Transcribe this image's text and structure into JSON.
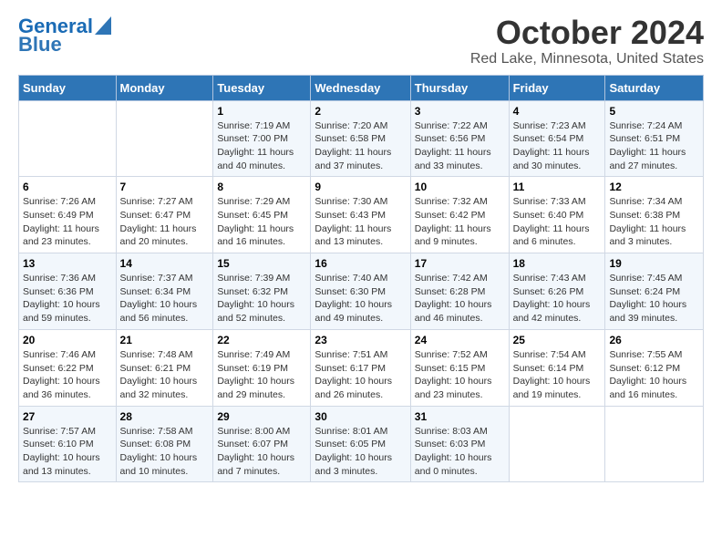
{
  "header": {
    "logo_line1": "General",
    "logo_line2": "Blue",
    "title": "October 2024",
    "subtitle": "Red Lake, Minnesota, United States"
  },
  "days_of_week": [
    "Sunday",
    "Monday",
    "Tuesday",
    "Wednesday",
    "Thursday",
    "Friday",
    "Saturday"
  ],
  "weeks": [
    [
      {
        "day": "",
        "info": ""
      },
      {
        "day": "",
        "info": ""
      },
      {
        "day": "1",
        "info": "Sunrise: 7:19 AM\nSunset: 7:00 PM\nDaylight: 11 hours and 40 minutes."
      },
      {
        "day": "2",
        "info": "Sunrise: 7:20 AM\nSunset: 6:58 PM\nDaylight: 11 hours and 37 minutes."
      },
      {
        "day": "3",
        "info": "Sunrise: 7:22 AM\nSunset: 6:56 PM\nDaylight: 11 hours and 33 minutes."
      },
      {
        "day": "4",
        "info": "Sunrise: 7:23 AM\nSunset: 6:54 PM\nDaylight: 11 hours and 30 minutes."
      },
      {
        "day": "5",
        "info": "Sunrise: 7:24 AM\nSunset: 6:51 PM\nDaylight: 11 hours and 27 minutes."
      }
    ],
    [
      {
        "day": "6",
        "info": "Sunrise: 7:26 AM\nSunset: 6:49 PM\nDaylight: 11 hours and 23 minutes."
      },
      {
        "day": "7",
        "info": "Sunrise: 7:27 AM\nSunset: 6:47 PM\nDaylight: 11 hours and 20 minutes."
      },
      {
        "day": "8",
        "info": "Sunrise: 7:29 AM\nSunset: 6:45 PM\nDaylight: 11 hours and 16 minutes."
      },
      {
        "day": "9",
        "info": "Sunrise: 7:30 AM\nSunset: 6:43 PM\nDaylight: 11 hours and 13 minutes."
      },
      {
        "day": "10",
        "info": "Sunrise: 7:32 AM\nSunset: 6:42 PM\nDaylight: 11 hours and 9 minutes."
      },
      {
        "day": "11",
        "info": "Sunrise: 7:33 AM\nSunset: 6:40 PM\nDaylight: 11 hours and 6 minutes."
      },
      {
        "day": "12",
        "info": "Sunrise: 7:34 AM\nSunset: 6:38 PM\nDaylight: 11 hours and 3 minutes."
      }
    ],
    [
      {
        "day": "13",
        "info": "Sunrise: 7:36 AM\nSunset: 6:36 PM\nDaylight: 10 hours and 59 minutes."
      },
      {
        "day": "14",
        "info": "Sunrise: 7:37 AM\nSunset: 6:34 PM\nDaylight: 10 hours and 56 minutes."
      },
      {
        "day": "15",
        "info": "Sunrise: 7:39 AM\nSunset: 6:32 PM\nDaylight: 10 hours and 52 minutes."
      },
      {
        "day": "16",
        "info": "Sunrise: 7:40 AM\nSunset: 6:30 PM\nDaylight: 10 hours and 49 minutes."
      },
      {
        "day": "17",
        "info": "Sunrise: 7:42 AM\nSunset: 6:28 PM\nDaylight: 10 hours and 46 minutes."
      },
      {
        "day": "18",
        "info": "Sunrise: 7:43 AM\nSunset: 6:26 PM\nDaylight: 10 hours and 42 minutes."
      },
      {
        "day": "19",
        "info": "Sunrise: 7:45 AM\nSunset: 6:24 PM\nDaylight: 10 hours and 39 minutes."
      }
    ],
    [
      {
        "day": "20",
        "info": "Sunrise: 7:46 AM\nSunset: 6:22 PM\nDaylight: 10 hours and 36 minutes."
      },
      {
        "day": "21",
        "info": "Sunrise: 7:48 AM\nSunset: 6:21 PM\nDaylight: 10 hours and 32 minutes."
      },
      {
        "day": "22",
        "info": "Sunrise: 7:49 AM\nSunset: 6:19 PM\nDaylight: 10 hours and 29 minutes."
      },
      {
        "day": "23",
        "info": "Sunrise: 7:51 AM\nSunset: 6:17 PM\nDaylight: 10 hours and 26 minutes."
      },
      {
        "day": "24",
        "info": "Sunrise: 7:52 AM\nSunset: 6:15 PM\nDaylight: 10 hours and 23 minutes."
      },
      {
        "day": "25",
        "info": "Sunrise: 7:54 AM\nSunset: 6:14 PM\nDaylight: 10 hours and 19 minutes."
      },
      {
        "day": "26",
        "info": "Sunrise: 7:55 AM\nSunset: 6:12 PM\nDaylight: 10 hours and 16 minutes."
      }
    ],
    [
      {
        "day": "27",
        "info": "Sunrise: 7:57 AM\nSunset: 6:10 PM\nDaylight: 10 hours and 13 minutes."
      },
      {
        "day": "28",
        "info": "Sunrise: 7:58 AM\nSunset: 6:08 PM\nDaylight: 10 hours and 10 minutes."
      },
      {
        "day": "29",
        "info": "Sunrise: 8:00 AM\nSunset: 6:07 PM\nDaylight: 10 hours and 7 minutes."
      },
      {
        "day": "30",
        "info": "Sunrise: 8:01 AM\nSunset: 6:05 PM\nDaylight: 10 hours and 3 minutes."
      },
      {
        "day": "31",
        "info": "Sunrise: 8:03 AM\nSunset: 6:03 PM\nDaylight: 10 hours and 0 minutes."
      },
      {
        "day": "",
        "info": ""
      },
      {
        "day": "",
        "info": ""
      }
    ]
  ]
}
